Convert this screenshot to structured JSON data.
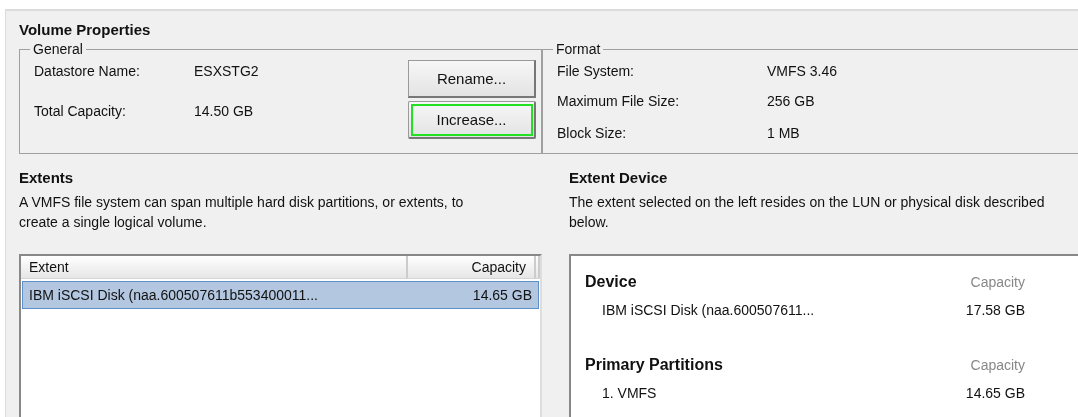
{
  "title": "Volume Properties",
  "general": {
    "legend": "General",
    "fields": [
      {
        "label": "Datastore Name:",
        "value": "ESXSTG2"
      },
      {
        "label": "Total Capacity:",
        "value": "14.50 GB"
      }
    ],
    "buttons": [
      {
        "label": "Rename...",
        "highlighted": false
      },
      {
        "label": "Increase...",
        "highlighted": true
      }
    ]
  },
  "format": {
    "legend": "Format",
    "fields": [
      {
        "label": "File System:",
        "value": "VMFS 3.46"
      },
      {
        "label": "Maximum File Size:",
        "value": "256 GB"
      },
      {
        "label": "Block Size:",
        "value": "1 MB"
      }
    ]
  },
  "extents": {
    "title": "Extents",
    "description": "A VMFS file system can span multiple hard disk partitions, or extents, to create a single logical volume.",
    "columns": [
      "Extent",
      "Capacity"
    ],
    "rows": [
      {
        "extent": "IBM iSCSI Disk (naa.600507611b553400011...",
        "capacity": "14.65 GB",
        "selected": true
      }
    ]
  },
  "extent_device": {
    "title": "Extent Device",
    "description": "The extent selected on the left resides on the LUN or physical disk described below.",
    "sections": [
      {
        "heading": "Device",
        "column": "Capacity",
        "rows": [
          {
            "name": "IBM iSCSI Disk (naa.600507611...",
            "capacity": "17.58 GB"
          }
        ]
      },
      {
        "heading": "Primary Partitions",
        "column": "Capacity",
        "rows": [
          {
            "name": "1. VMFS",
            "capacity": "14.65 GB"
          }
        ]
      }
    ]
  }
}
